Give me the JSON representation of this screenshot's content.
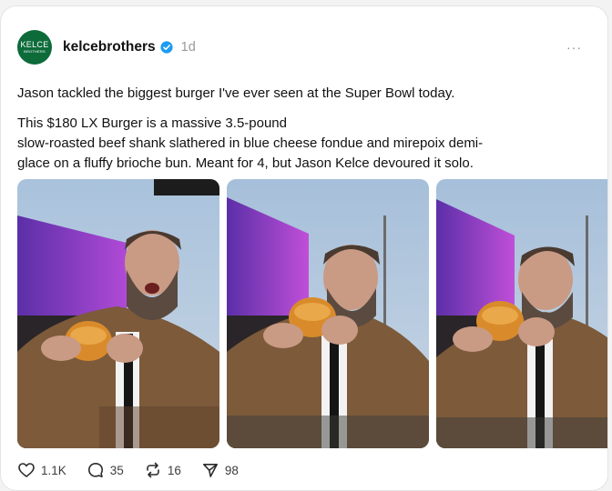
{
  "post": {
    "avatar": {
      "line1": "KELCE",
      "line2": "BROTHERS"
    },
    "username": "kelcebrothers",
    "time": "1d",
    "more_label": "···",
    "paragraph1": "Jason tackled the biggest burger I've ever seen at the Super Bowl today.",
    "paragraph2_lines": [
      "This $180 LX Burger is a massive 3.5-pound",
      "slow-roasted beef shank slathered in blue cheese fondue and mirepoix demi-",
      "glace on a fluffy brioche bun. Meant for 4, but Jason Kelce devoured it solo."
    ],
    "actions": {
      "likes": "1.1K",
      "comments": "35",
      "reposts": "16",
      "shares": "98"
    }
  },
  "colors": {
    "verified": "#1d9bf0",
    "avatar_bg": "#0d6b3a"
  },
  "icons": [
    "verified-badge-icon",
    "heart-icon",
    "comment-icon",
    "repost-icon",
    "share-icon"
  ]
}
